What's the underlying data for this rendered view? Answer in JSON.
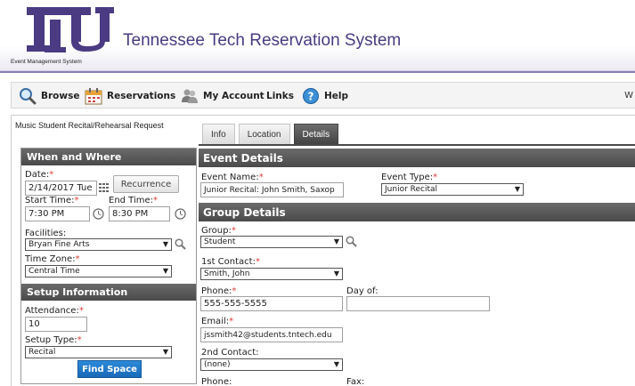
{
  "header": {
    "logo_subtitle": "Event Management System",
    "title": "Tennessee Tech Reservation System"
  },
  "nav": {
    "items": [
      {
        "label": "Browse",
        "icon": "magnifier-icon"
      },
      {
        "label": "Reservations",
        "icon": "calendar-icon"
      },
      {
        "label": "My Account",
        "icon": "users-icon"
      },
      {
        "label": "Links"
      },
      {
        "label": "Help",
        "icon": "help-icon"
      }
    ],
    "cut_text": "W"
  },
  "request": {
    "name": "Music Student Recital/Rehearsal Request"
  },
  "tabs": [
    {
      "label": "Info",
      "active": false
    },
    {
      "label": "Location",
      "active": false
    },
    {
      "label": "Details",
      "active": true
    }
  ],
  "when_where": {
    "heading": "When and Where",
    "date_label": "Date:",
    "date_value": "2/14/2017 Tue",
    "recurrence_button": "Recurrence",
    "start_label": "Start Time:",
    "start_value": "7:30 PM",
    "end_label": "End Time:",
    "end_value": "8:30 PM",
    "facilities_label": "Facilities:",
    "facilities_value": "Bryan Fine Arts",
    "timezone_label": "Time Zone:",
    "timezone_value": "Central Time"
  },
  "setup": {
    "heading": "Setup Information",
    "attendance_label": "Attendance:",
    "attendance_value": "10",
    "setup_type_label": "Setup Type:",
    "setup_type_value": "Recital",
    "find_space_button": "Find Space"
  },
  "event_details": {
    "heading": "Event Details",
    "name_label": "Event Name:",
    "name_value": "Junior Recital: John Smith, Saxop",
    "type_label": "Event Type:",
    "type_value": "Junior Recital"
  },
  "group_details": {
    "heading": "Group Details",
    "group_label": "Group:",
    "group_value": "Student",
    "contact1_label": "1st Contact:",
    "contact1_value": "Smith, John",
    "phone_label": "Phone:",
    "phone_value": "555-555-5555",
    "dayof_label": "Day of:",
    "dayof_value": "",
    "email_label": "Email:",
    "email_value": "jssmith42@students.tntech.edu",
    "contact2_label": "2nd Contact:",
    "contact2_value": "(none)",
    "phone2_label": "Phone:",
    "fax_label": "Fax:"
  },
  "required_marker": "*",
  "colors": {
    "brand_purple": "#4a3b82",
    "section_header": "#4a4a4a",
    "find_space_blue": "#1a6ab8",
    "required_red": "#e03a3a"
  }
}
